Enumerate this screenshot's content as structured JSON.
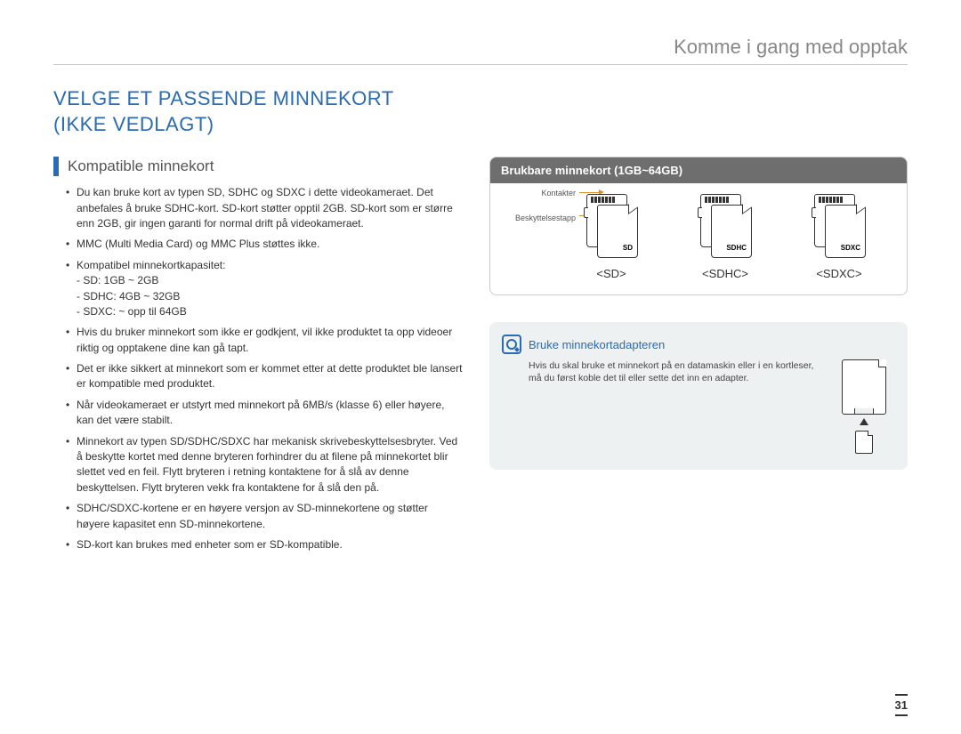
{
  "header": {
    "chapter": "Komme i gang med opptak"
  },
  "title": {
    "line1": "VELGE ET PASSENDE MINNEKORT",
    "line2": "(IKKE VEDLAGT)"
  },
  "subsection": {
    "title": "Kompatible minnekort"
  },
  "bullets": [
    "Du kan bruke kort av typen SD, SDHC og SDXC i dette videokameraet. Det anbefales å bruke SDHC-kort. SD-kort støtter opptil 2GB. SD-kort som er større enn 2GB, gir ingen garanti for normal drift på videokameraet.",
    "MMC (Multi Media Card) og MMC Plus støttes ikke.",
    "Kompatibel minnekortkapasitet:\n- SD: 1GB ~ 2GB\n- SDHC: 4GB ~ 32GB\n- SDXC: ~ opp til 64GB",
    "Hvis du bruker minnekort som ikke er godkjent, vil ikke produktet ta opp videoer riktig og opptakene dine kan gå tapt.",
    "Det er ikke sikkert at minnekort som er kommet etter at dette produktet ble lansert er kompatible med produktet.",
    "Når videokameraet er utstyrt med minnekort på 6MB/s (klasse 6) eller høyere, kan det være stabilt.",
    "Minnekort av typen SD/SDHC/SDXC har mekanisk skrivebeskyttelsesbryter. Ved å beskytte kortet med denne bryteren forhindrer du at filene på minnekortet blir slettet ved en feil. Flytt bryteren i retning kontaktene for å slå av denne beskyttelsen. Flytt bryteren vekk fra kontaktene for å slå den på.",
    "SDHC/SDXC-kortene er en høyere versjon av SD-minnekortene og støtter høyere kapasitet enn SD-minnekortene.",
    "SD-kort kan brukes med enheter som er SD-kompatible."
  ],
  "card_box": {
    "header": "Brukbare minnekort (1GB~64GB)",
    "label_contacts": "Kontakter",
    "label_protect": "Beskyttelsestapp",
    "types": [
      "<SD>",
      "<SDHC>",
      "<SDXC>"
    ],
    "logos": [
      "SD",
      "SDHC",
      "SDXC"
    ]
  },
  "tip": {
    "title": "Bruke minnekortadapteren",
    "text": "Hvis du skal bruke et minnekort på en datamaskin eller i en kortleser, må du først koble det til eller sette det inn en adapter."
  },
  "page_number": "31"
}
